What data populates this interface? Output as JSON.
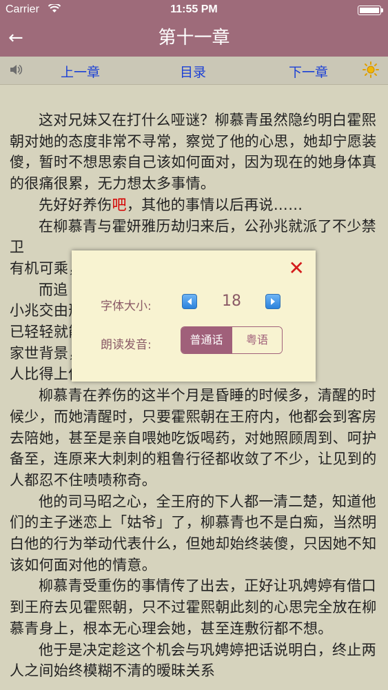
{
  "status_bar": {
    "carrier": "Carrier",
    "time": "11:55 PM"
  },
  "nav": {
    "back_icon": "←",
    "title": "第十一章"
  },
  "toolbar": {
    "speaker_icon": "speaker-icon",
    "prev_label": "上一章",
    "toc_label": "目录",
    "next_label": "下一章",
    "brightness_icon": "sun-icon"
  },
  "content": {
    "paragraphs": [
      "这对兄妹又在打什么哑谜？柳慕青虽然隐约明白霍熙朝对她的态度非常不寻常，察觉了他的心思，她却宁愿装傻，暂时不想思索自己该如何面对，因为现在的她身体真的很痛很累，无力想太多事情。",
      "先好好养伤",
      "吧",
      "，其他的事情以后再说……",
      "在柳慕青与霍妍雅历劫归来后，公孙兆就派了不少禁卫",
      "有机可乘，害了",
      "而追",
      "小兆交由刑部侍郎",
      "已轻轻就能坐上刑",
      "家世背景，他办",
      "人比得上他。",
      "柳慕青在养伤的这半个月是昏睡的时候多，清醒的时候少，而她清醒时，只要霍熙朝在王府内，他都会到客房去陪她，甚至是亲自喂她吃饭喝药，对她照顾周到、呵护备至，连原来大刺刺的粗鲁行径都收敛了不少，让见到的人都忍不住啧啧称奇。",
      "他的司马昭之心，全王府的下人都一清二楚，知道他们的主子迷恋上「姑爷」了，柳慕青也不是白痴，当然明白他的行为举动代表什么，但她却始终装傻，只因她不知该如何面对他的情意。",
      "柳慕青受重伤的事情传了出去，正好让巩娉婷有借口到王府去见霍熙朝，只不过霍熙朝此刻的心思完全放在柳慕青身上，根本无心理会她，甚至连敷衍都不想。",
      "他于是决定趁这个机会与巩娉婷把话说明白，终止两人之间始终模糊不清的暧昧关系"
    ]
  },
  "modal": {
    "close_icon": "✕",
    "font_size_label": "字体大小:",
    "font_size_value": "18",
    "pronunciation_label": "朗读发音:",
    "options": [
      "普通话",
      "粤语"
    ],
    "selected_option": "普通话"
  },
  "colors": {
    "nav_bg": "#9e6b7a",
    "page_bg": "#d6d3bd",
    "modal_bg": "#f8f3d1",
    "accent": "#a0607a",
    "link_blue": "#1a3fd6",
    "close_red": "#d41c1c"
  }
}
